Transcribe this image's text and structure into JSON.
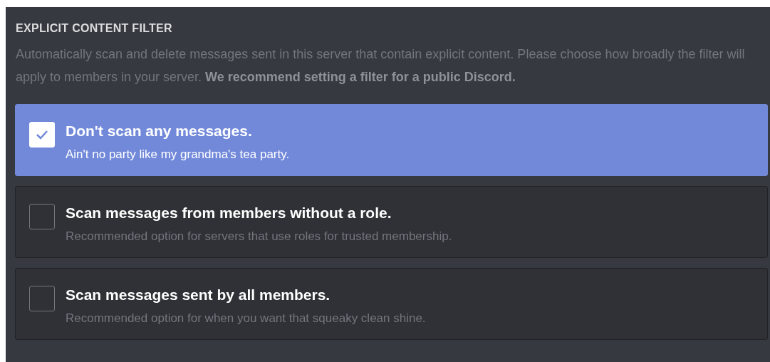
{
  "section": {
    "title": "EXPLICIT CONTENT FILTER",
    "description": "Automatically scan and delete messages sent in this server that contain explicit content. Please choose how broadly the filter will apply to members in your server. **We recommend setting a filter for a public Discord.**"
  },
  "options": [
    {
      "title": "Don't scan any messages.",
      "subtitle": "Ain't no party like my grandma's tea party.",
      "selected": true
    },
    {
      "title": "Scan messages from members without a role.",
      "subtitle": "Recommended option for servers that use roles for trusted membership.",
      "selected": false
    },
    {
      "title": "Scan messages sent by all members.",
      "subtitle": "Recommended option for when you want that squeaky clean shine.",
      "selected": false
    }
  ]
}
